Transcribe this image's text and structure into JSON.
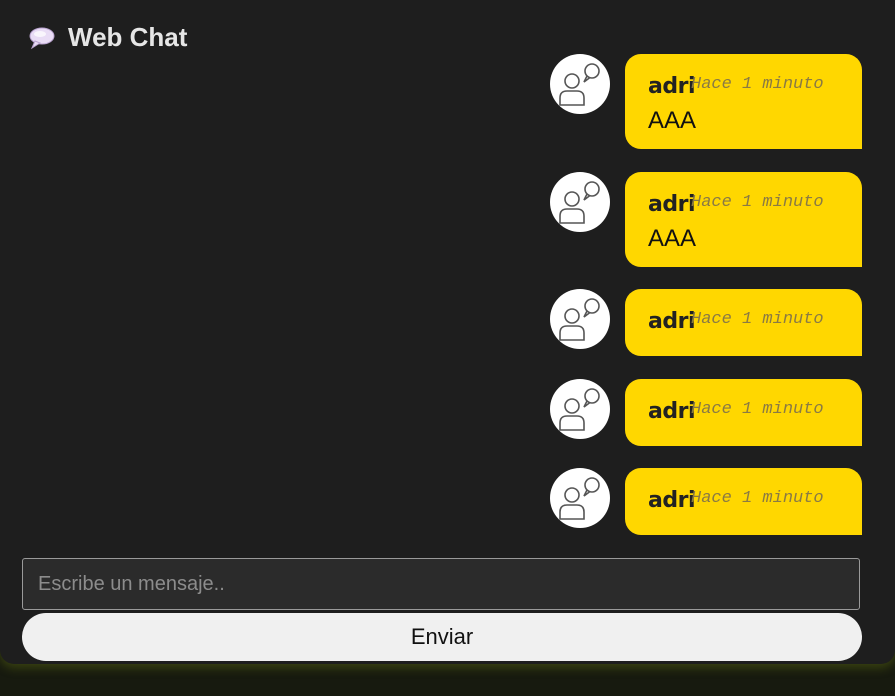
{
  "header": {
    "title": "Web Chat",
    "icon": "speech-bubble-icon"
  },
  "messages": [
    {
      "author": "adri",
      "time": "Hace 1 minuto",
      "text": "AAA",
      "avatar": "user-chat-avatar-icon"
    },
    {
      "author": "adri",
      "time": "Hace 1 minuto",
      "text": "AAA",
      "avatar": "user-chat-avatar-icon"
    },
    {
      "author": "adri",
      "time": "Hace 1 minuto",
      "text": "",
      "avatar": "user-chat-avatar-icon"
    },
    {
      "author": "adri",
      "time": "Hace 1 minuto",
      "text": "",
      "avatar": "user-chat-avatar-icon"
    },
    {
      "author": "adri",
      "time": "Hace 1 minuto",
      "text": "",
      "avatar": "user-chat-avatar-icon"
    }
  ],
  "composer": {
    "placeholder": "Escribe un mensaje..",
    "value": "",
    "send_label": "Enviar"
  },
  "colors": {
    "bubble": "#ffd700",
    "background": "#1e1e1e",
    "button": "#f0f0f0"
  }
}
